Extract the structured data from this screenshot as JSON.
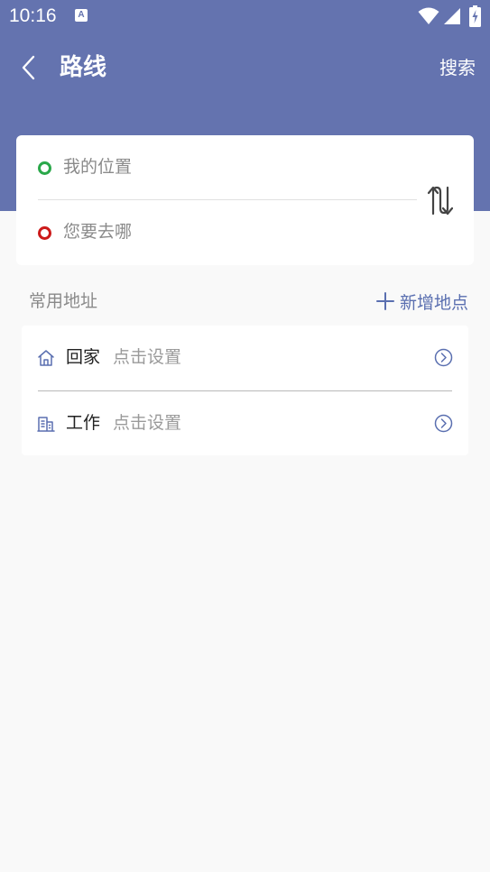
{
  "status_bar": {
    "time": "10:16",
    "notification_icon": "a-icon",
    "wifi_icon": "wifi-icon",
    "signal_icon": "signal-icon",
    "battery_icon": "battery-charging-icon"
  },
  "header": {
    "back_icon": "chevron-left-icon",
    "title": "路线",
    "search_label": "搜索"
  },
  "route": {
    "start_placeholder": "我的位置",
    "end_placeholder": "您要去哪",
    "swap_icon": "swap-vertical-icon"
  },
  "common_places": {
    "section_label": "常用地址",
    "add_label": "新增地点",
    "items": [
      {
        "icon": "home-icon",
        "name": "回家",
        "hint": "点击设置",
        "action_icon": "chevron-right-circle-icon"
      },
      {
        "icon": "office-building-icon",
        "name": "工作",
        "hint": "点击设置",
        "action_icon": "chevron-right-circle-icon"
      }
    ]
  },
  "colors": {
    "header": "#6473af",
    "accent": "#5a6fb0",
    "start_dot": "#2aa84a",
    "end_dot": "#cc1a1a",
    "background": "#f9f9f9"
  }
}
